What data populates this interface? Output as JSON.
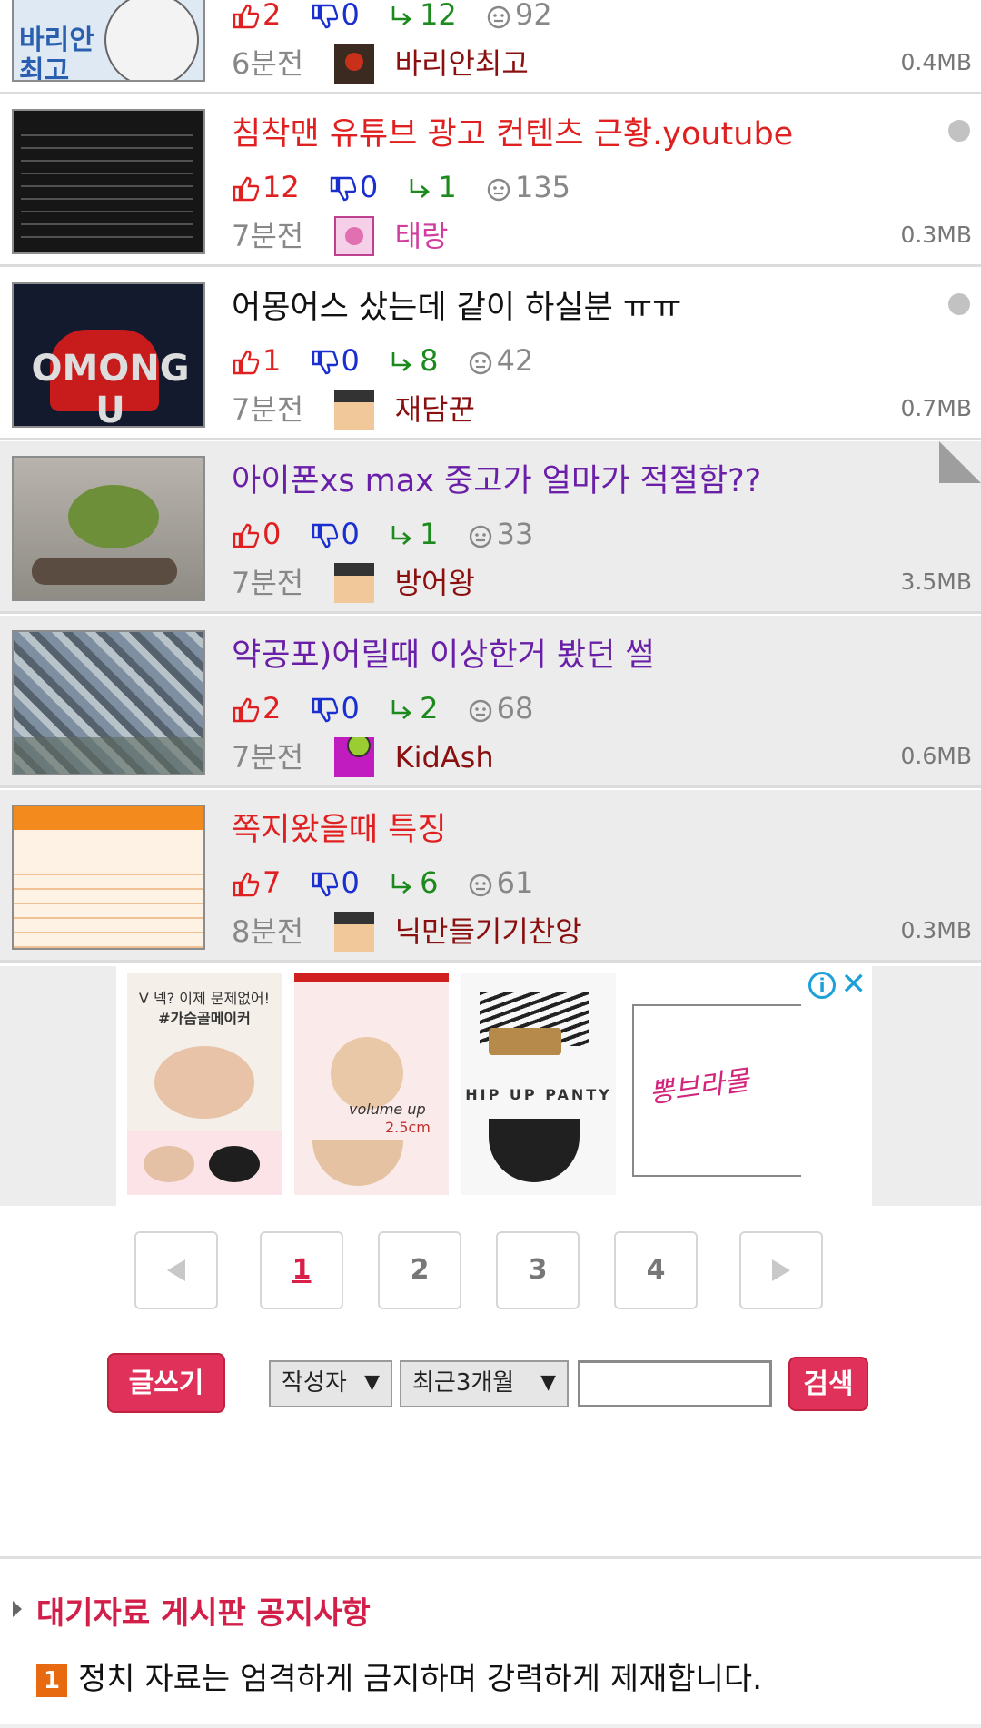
{
  "posts": [
    {
      "title": "",
      "title_color": "red",
      "up": "2",
      "down": "0",
      "reply": "12",
      "views": "92",
      "time": "6분전",
      "author": "바리안최고",
      "size": "0.4MB",
      "read": false,
      "dot": false
    },
    {
      "title": "침착맨 유튜브 광고 컨텐츠 근황.youtube",
      "title_color": "red",
      "up": "12",
      "down": "0",
      "reply": "1",
      "views": "135",
      "time": "7분전",
      "author": "태랑",
      "size": "0.3MB",
      "read": false,
      "dot": true
    },
    {
      "title": "어몽어스 샀는데 같이 하실분 ㅠㅠ",
      "title_color": "black",
      "up": "1",
      "down": "0",
      "reply": "8",
      "views": "42",
      "time": "7분전",
      "author": "재담꾼",
      "size": "0.7MB",
      "read": false,
      "dot": true
    },
    {
      "title": "아이폰xs max 중고가 얼마가 적절함??",
      "title_color": "purple",
      "up": "0",
      "down": "0",
      "reply": "1",
      "views": "33",
      "time": "7분전",
      "author": "방어왕",
      "size": "3.5MB",
      "read": true,
      "dot": false
    },
    {
      "title": "약공포)어릴때 이상한거 봤던 썰",
      "title_color": "purple",
      "up": "2",
      "down": "0",
      "reply": "2",
      "views": "68",
      "time": "7분전",
      "author": "KidAsh",
      "size": "0.6MB",
      "read": true,
      "dot": false
    },
    {
      "title": "쪽지왔을때 특징",
      "title_color": "red",
      "up": "7",
      "down": "0",
      "reply": "6",
      "views": "61",
      "time": "8분전",
      "author": "닉만들기기찬앙",
      "size": "0.3MB",
      "read": true,
      "dot": false
    }
  ],
  "ad": {
    "card1_caption": "V 넥? 이제 문제없어!",
    "card1_tag": "#가슴골메이커",
    "card2_caption": "volume up",
    "card2_sub": "2.5cm",
    "card3_caption": "HIP UP PANTY",
    "card4_brand": "뽕브라몰",
    "info_icon": "info-icon",
    "close_icon": "close-icon"
  },
  "pagination": {
    "prev": "prev-icon",
    "pages": [
      "1",
      "2",
      "3",
      "4"
    ],
    "current": "1",
    "next": "next-icon"
  },
  "controls": {
    "write_label": "글쓰기",
    "search_field": "작성자",
    "period": "최근3개월",
    "search_value": "",
    "search_label": "검색",
    "arrow": "▼"
  },
  "notice": {
    "title": "대기자료 게시판 공지사항",
    "items": [
      {
        "num": "1",
        "text": "정치 자료는 엄격하게 금지하며 강력하게 제재합니다."
      }
    ]
  },
  "colors": {
    "red": "#e02020",
    "purple": "#6a1fa8",
    "accent": "#e0315a",
    "author": "#8a1010"
  }
}
